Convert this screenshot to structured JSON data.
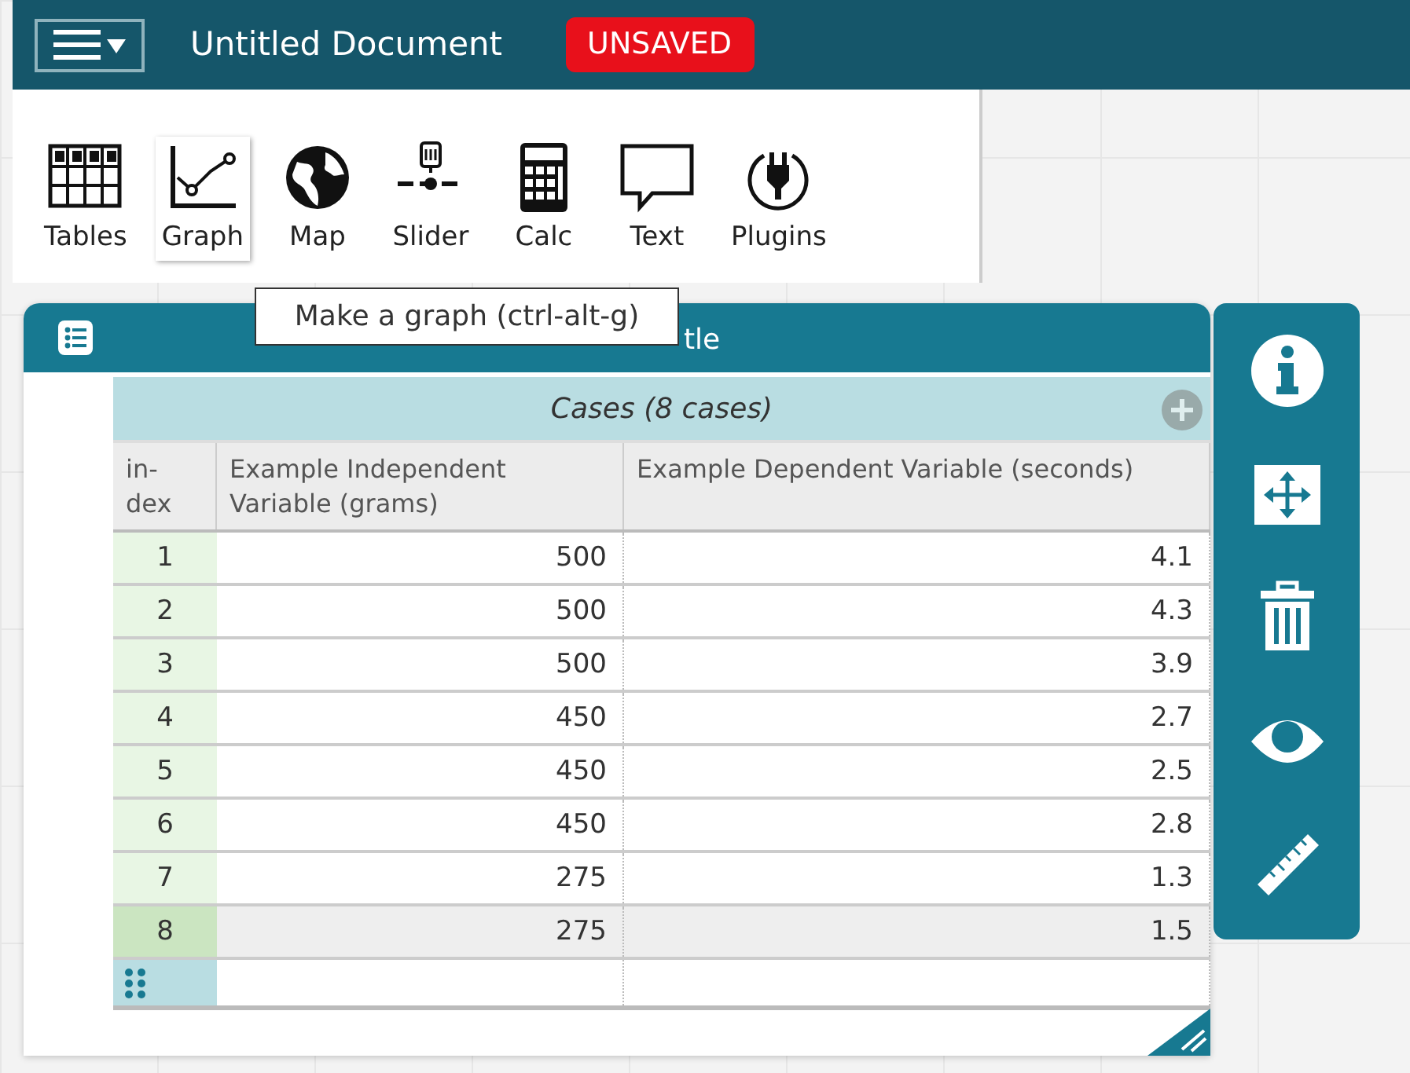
{
  "topbar": {
    "title": "Untitled Document",
    "badge": "UNSAVED"
  },
  "tools": [
    {
      "kind": "tables",
      "label": "Tables",
      "selected": false
    },
    {
      "kind": "graph",
      "label": "Graph",
      "selected": true
    },
    {
      "kind": "map",
      "label": "Map",
      "selected": false
    },
    {
      "kind": "slider",
      "label": "Slider",
      "selected": false
    },
    {
      "kind": "calc",
      "label": "Calc",
      "selected": false
    },
    {
      "kind": "text",
      "label": "Text",
      "selected": false
    },
    {
      "kind": "plugins",
      "label": "Plugins",
      "selected": false
    }
  ],
  "tooltip": "Make a graph (ctrl-alt-g)",
  "table": {
    "title": "tle",
    "cases": "Cases (8 cases)",
    "columns": [
      "in-\ndex",
      "Example Independent Variable (grams)",
      "Example Dependent Variable (seconds)"
    ],
    "rows": [
      {
        "index": "1",
        "values": [
          "500",
          "4.1"
        ],
        "selected": false
      },
      {
        "index": "2",
        "values": [
          "500",
          "4.3"
        ],
        "selected": false
      },
      {
        "index": "3",
        "values": [
          "500",
          "3.9"
        ],
        "selected": false
      },
      {
        "index": "4",
        "values": [
          "450",
          "2.7"
        ],
        "selected": false
      },
      {
        "index": "5",
        "values": [
          "450",
          "2.5"
        ],
        "selected": false
      },
      {
        "index": "6",
        "values": [
          "450",
          "2.8"
        ],
        "selected": false
      },
      {
        "index": "7",
        "values": [
          "275",
          "1.3"
        ],
        "selected": false
      },
      {
        "index": "8",
        "values": [
          "275",
          "1.5"
        ],
        "selected": true
      }
    ]
  },
  "inspector": [
    {
      "kind": "info"
    },
    {
      "kind": "move"
    },
    {
      "kind": "trash"
    },
    {
      "kind": "eye"
    },
    {
      "kind": "ruler"
    }
  ]
}
